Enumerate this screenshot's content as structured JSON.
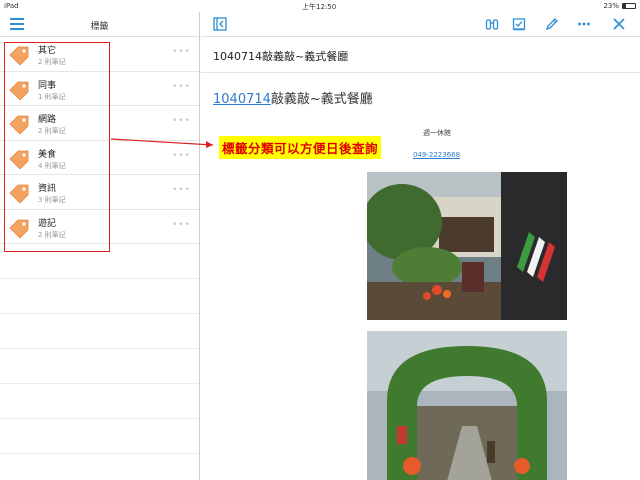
{
  "status_bar": {
    "carrier": "iPad",
    "time": "上午12:50",
    "battery": "23%",
    "battery_level": 0.23
  },
  "sidebar": {
    "title": "標籤",
    "tags": [
      {
        "name": "其它",
        "count": "2 則筆記"
      },
      {
        "name": "同事",
        "count": "1 則筆記"
      },
      {
        "name": "網路",
        "count": "2 則筆記"
      },
      {
        "name": "美食",
        "count": "4 則筆記"
      },
      {
        "name": "資訊",
        "count": "3 則筆記"
      },
      {
        "name": "遊記",
        "count": "2 則筆記"
      }
    ]
  },
  "note": {
    "title": "1040714敲義敲~義式餐廳",
    "heading_date": "1040714",
    "heading_text": "敲義敲~義式餐廳",
    "closed": "週一休館",
    "phone": "049-2223668"
  },
  "annotation": {
    "label": "標籤分類可以方便日後查詢"
  },
  "colors": {
    "accent": "#2b8fd6",
    "tag_orange": "#f4a261",
    "annotation_red": "#e00000",
    "annotation_bg": "#ffff00"
  }
}
